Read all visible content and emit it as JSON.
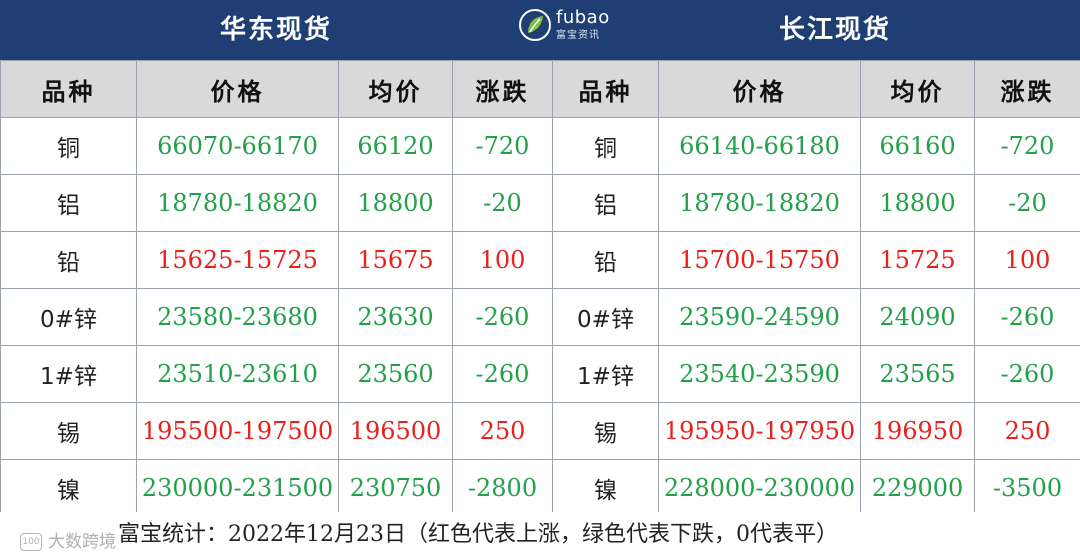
{
  "header": {
    "left_title": "华东现货",
    "right_title": "长江现货",
    "logo_en": "fubao",
    "logo_cn": "富宝资讯",
    "color": "#1f3f74"
  },
  "columns": [
    "品种",
    "价格",
    "均价",
    "涨跌",
    "品种",
    "价格",
    "均价",
    "涨跌"
  ],
  "rows": [
    {
      "name": "铜",
      "trend": "down",
      "east": {
        "price": "66070-66170",
        "avg": "66120",
        "change": "-720"
      },
      "yangtze": {
        "name": "铜",
        "price": "66140-66180",
        "avg": "66160",
        "change": "-720"
      }
    },
    {
      "name": "铝",
      "trend": "down",
      "east": {
        "price": "18780-18820",
        "avg": "18800",
        "change": "-20"
      },
      "yangtze": {
        "name": "铝",
        "price": "18780-18820",
        "avg": "18800",
        "change": "-20"
      }
    },
    {
      "name": "铅",
      "trend": "up",
      "east": {
        "price": "15625-15725",
        "avg": "15675",
        "change": "100"
      },
      "yangtze": {
        "name": "铅",
        "price": "15700-15750",
        "avg": "15725",
        "change": "100"
      }
    },
    {
      "name": "0#锌",
      "trend": "down",
      "east": {
        "price": "23580-23680",
        "avg": "23630",
        "change": "-260"
      },
      "yangtze": {
        "name": "0#锌",
        "price": "23590-24590",
        "avg": "24090",
        "change": "-260"
      }
    },
    {
      "name": "1#锌",
      "trend": "down",
      "east": {
        "price": "23510-23610",
        "avg": "23560",
        "change": "-260"
      },
      "yangtze": {
        "name": "1#锌",
        "price": "23540-23590",
        "avg": "23565",
        "change": "-260"
      }
    },
    {
      "name": "锡",
      "trend": "up",
      "east": {
        "price": "195500-197500",
        "avg": "196500",
        "change": "250"
      },
      "yangtze": {
        "name": "锡",
        "price": "195950-197950",
        "avg": "196950",
        "change": "250"
      }
    },
    {
      "name": "镍",
      "trend": "down",
      "east": {
        "price": "230000-231500",
        "avg": "230750",
        "change": "-2800"
      },
      "yangtze": {
        "name": "镍",
        "price": "228000-230000",
        "avg": "229000",
        "change": "-3500"
      }
    }
  ],
  "colors": {
    "up": "#e8211b",
    "down": "#22a04a",
    "header_bg": "#d9d9d9"
  },
  "footer": {
    "text": "富宝统计：2022年12月23日（红色代表上涨，绿色代表下跌，0代表平）",
    "watermark": "大数跨境",
    "watermark_badge": "100"
  }
}
